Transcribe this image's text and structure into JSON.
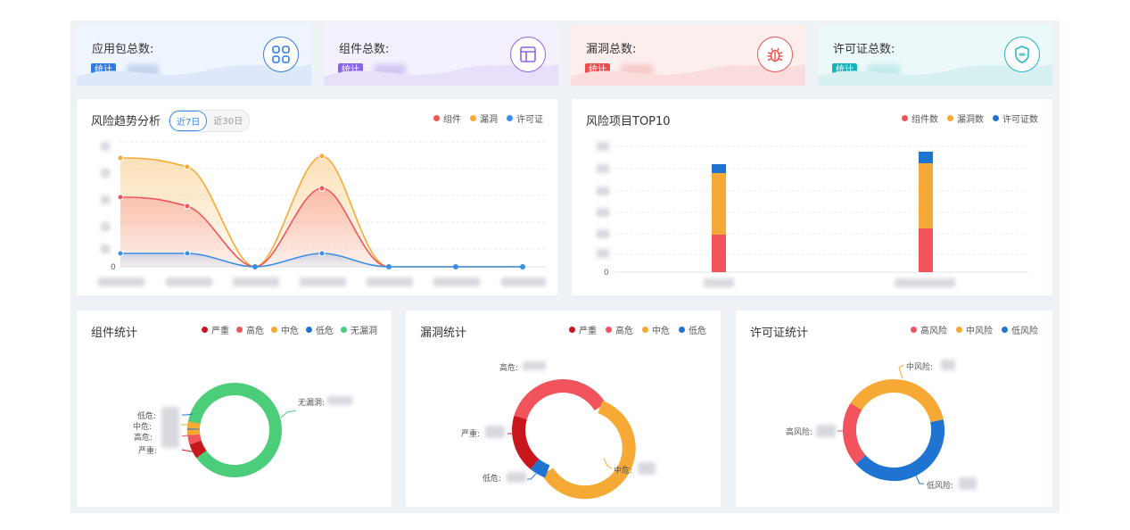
{
  "stats": [
    {
      "title": "应用包总数:",
      "tag": "统计",
      "icon": "apps-grid-icon",
      "accent": "#2f7be6",
      "tag_color": "#2f7be6",
      "bg": "#eef5fe",
      "wave": "#dde9fa"
    },
    {
      "title": "组件总数:",
      "tag": "统计",
      "icon": "layout-icon",
      "accent": "#8e66e6",
      "tag_color": "#8c63e6",
      "bg": "#f4f0fe",
      "wave": "#e8e0fb"
    },
    {
      "title": "漏洞总数:",
      "tag": "统计",
      "icon": "bug-icon",
      "accent": "#ef5350",
      "tag_color": "#ec4c4a",
      "bg": "#fdeeee",
      "wave": "#fadcdc"
    },
    {
      "title": "许可证总数:",
      "tag": "统计",
      "icon": "license-shield-icon",
      "accent": "#1fb7bd",
      "tag_color": "#15b3b9",
      "bg": "#ecf9fa",
      "wave": "#d7f1f3"
    }
  ],
  "trend": {
    "title": "风险趋势分析",
    "tabs": [
      "近7日",
      "近30日"
    ],
    "active_tab": "近7日",
    "legend": [
      {
        "name": "组件",
        "color": "#f2545b"
      },
      {
        "name": "漏洞",
        "color": "#f7a935"
      },
      {
        "name": "许可证",
        "color": "#3a8ee6"
      }
    ],
    "y_zero": "0"
  },
  "top10": {
    "title": "风险项目TOP10",
    "legend": [
      {
        "name": "组件数",
        "color": "#f2545b"
      },
      {
        "name": "漏洞数",
        "color": "#f7a935"
      },
      {
        "name": "许可证数",
        "color": "#1f74d1"
      }
    ],
    "y_zero": "0"
  },
  "component_stats": {
    "title": "组件统计",
    "legend": [
      {
        "name": "严重",
        "color": "#c8161d"
      },
      {
        "name": "高危",
        "color": "#f2545b"
      },
      {
        "name": "中危",
        "color": "#f7a935"
      },
      {
        "name": "低危",
        "color": "#1f74d1"
      },
      {
        "name": "无漏洞",
        "color": "#4ccd79"
      }
    ],
    "labels": [
      "低危:",
      "中危:",
      "高危:",
      "严重:",
      "无漏洞:"
    ]
  },
  "vuln_stats": {
    "title": "漏洞统计",
    "legend": [
      {
        "name": "严重",
        "color": "#c8161d"
      },
      {
        "name": "高危",
        "color": "#f2545b"
      },
      {
        "name": "中危",
        "color": "#f7a935"
      },
      {
        "name": "低危",
        "color": "#1f74d1"
      }
    ],
    "labels": [
      "高危:",
      "严重:",
      "低危:",
      "中危:"
    ]
  },
  "license_stats": {
    "title": "许可证统计",
    "legend": [
      {
        "name": "高风险",
        "color": "#f2545b"
      },
      {
        "name": "中风险",
        "color": "#f7a935"
      },
      {
        "name": "低风险",
        "color": "#1f74d1"
      }
    ],
    "labels": [
      "中风险:",
      "高风险:",
      "低风险:"
    ]
  }
}
